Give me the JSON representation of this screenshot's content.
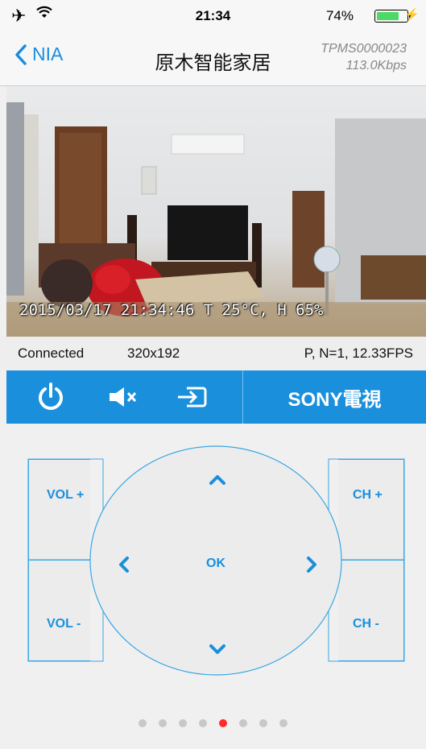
{
  "status_bar": {
    "time": "21:34",
    "battery_percent": "74%",
    "battery_level": 0.74,
    "icons": [
      "airplane-icon",
      "wifi-icon",
      "battery-icon",
      "charging-icon"
    ]
  },
  "nav": {
    "back_label": "NIA",
    "title": "原木智能家居",
    "device_id": "TPMS0000023",
    "bitrate": "113.0Kbps"
  },
  "video": {
    "osd_text": "2015/03/17 21:34:46  T 25°C, H 65%"
  },
  "info": {
    "status": "Connected",
    "resolution": "320x192",
    "stats": "P, N=1, 12.33FPS"
  },
  "controls": {
    "device_label": "SONY電視",
    "icons": [
      "power-icon",
      "mute-icon",
      "input-source-icon"
    ]
  },
  "remote": {
    "vol_up": "VOL +",
    "vol_down": "VOL -",
    "ch_up": "CH +",
    "ch_down": "CH -",
    "ok": "OK",
    "icons": [
      "up-arrow-icon",
      "down-arrow-icon",
      "left-arrow-icon",
      "right-arrow-icon"
    ]
  },
  "pager": {
    "page_count": 8,
    "active_page": 5
  },
  "colors": {
    "accent": "#1a8fdc",
    "active_dot": "#ff2b2b",
    "battery": "#4cd964"
  }
}
